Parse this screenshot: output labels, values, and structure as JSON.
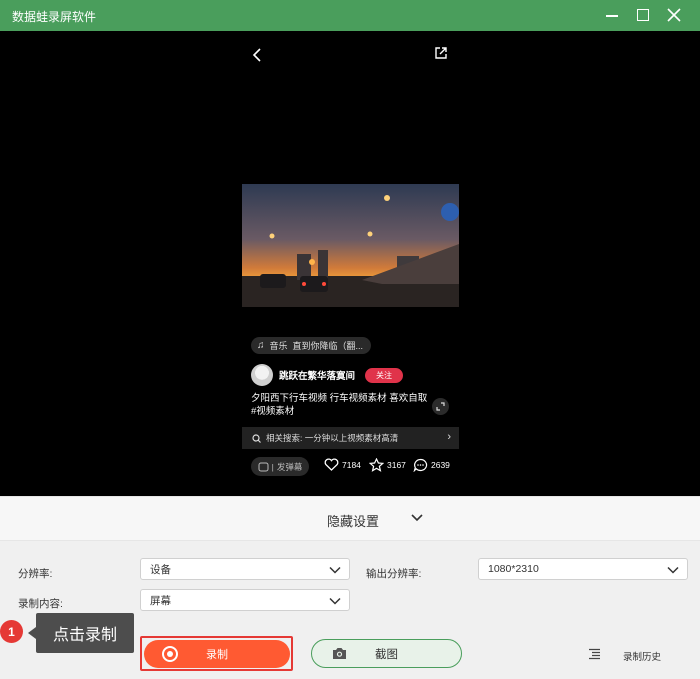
{
  "window": {
    "title": "数据蛙录屏软件"
  },
  "preview": {
    "music": {
      "prefix": "音乐",
      "text": "直到你降临（翻..."
    },
    "author": {
      "name": "跳跃在繁华落寞间",
      "follow_label": "关注"
    },
    "description": "夕阳西下行车视频 行车视频素材 喜欢自取 #视频素材",
    "related_search": "相关搜索: 一分钟以上视频素材高清",
    "post_label": "发弹幕",
    "stats": {
      "likes": "7184",
      "favorites": "3167",
      "comments": "2639"
    }
  },
  "hide_settings": {
    "label": "隐藏设置"
  },
  "settings": {
    "resolution_label": "分辨率:",
    "resolution_value": "设备",
    "output_resolution_label": "输出分辨率:",
    "output_resolution_value": "1080*2310",
    "content_label": "录制内容:",
    "content_value": "屏幕"
  },
  "tooltip": {
    "step": "1",
    "text": "点击录制"
  },
  "actions": {
    "record_label": "录制",
    "screenshot_label": "截图",
    "history_label": "录制历史"
  },
  "colors": {
    "title_bar": "#4a9e5c",
    "record": "#ff5a32",
    "highlight": "#e53935",
    "follow": "#e0334a"
  },
  "icons": [
    "back-arrow-icon",
    "share-icon",
    "music-note-icon",
    "expand-icon",
    "search-icon",
    "chevron-right-icon",
    "heart-icon",
    "star-icon",
    "comment-icon",
    "chevron-down-icon",
    "record-icon",
    "camera-icon",
    "list-icon"
  ]
}
